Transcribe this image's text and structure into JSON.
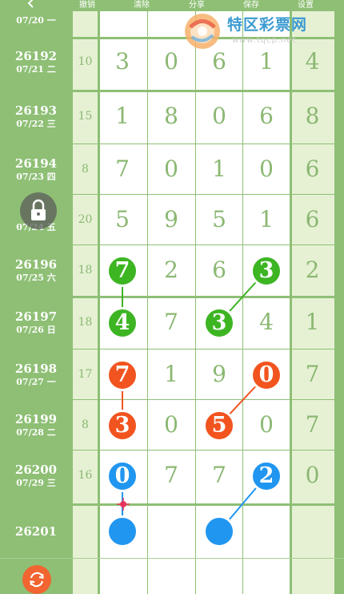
{
  "toolbar": {
    "back": "‹",
    "undo": "撤销",
    "clear": "清除",
    "share": "分享",
    "save": "保存",
    "settings": "设置"
  },
  "logo": {
    "text": "特区彩票网",
    "url": "www.tqcp.net"
  },
  "rows": [
    {
      "issue": "",
      "date": "07/20 一",
      "sum": "",
      "digits": [
        "",
        "",
        "",
        ""
      ],
      "extra": ""
    },
    {
      "issue": "26192",
      "date": "07/21 二",
      "sum": "10",
      "digits": [
        "3",
        "0",
        "6",
        "1"
      ],
      "extra": "4"
    },
    {
      "issue": "26193",
      "date": "07/22 三",
      "sum": "15",
      "digits": [
        "1",
        "8",
        "0",
        "6"
      ],
      "extra": "8"
    },
    {
      "issue": "26194",
      "date": "07/23 四",
      "sum": "8",
      "digits": [
        "7",
        "0",
        "1",
        "0"
      ],
      "extra": "6"
    },
    {
      "issue": "",
      "date": "07/24 五",
      "sum": "20",
      "digits": [
        "5",
        "9",
        "5",
        "1"
      ],
      "extra": "6"
    },
    {
      "issue": "26196",
      "date": "07/25 六",
      "sum": "18",
      "digits": [
        "7",
        "2",
        "6",
        "3"
      ],
      "extra": "2"
    },
    {
      "issue": "26197",
      "date": "07/26 日",
      "sum": "18",
      "digits": [
        "4",
        "7",
        "3",
        "4"
      ],
      "extra": "1"
    },
    {
      "issue": "26198",
      "date": "07/27 一",
      "sum": "17",
      "digits": [
        "7",
        "1",
        "9",
        "0"
      ],
      "extra": "7"
    },
    {
      "issue": "26199",
      "date": "07/28 二",
      "sum": "8",
      "digits": [
        "3",
        "0",
        "5",
        "0"
      ],
      "extra": "7"
    },
    {
      "issue": "26200",
      "date": "07/29 三",
      "sum": "16",
      "digits": [
        "0",
        "7",
        "7",
        "2"
      ],
      "extra": "0"
    },
    {
      "issue": "26201",
      "date": "",
      "sum": "",
      "digits": [
        "",
        "",
        "",
        ""
      ],
      "extra": ""
    }
  ],
  "marks": [
    {
      "row": 5,
      "col": 0,
      "color": "green",
      "label": "7"
    },
    {
      "row": 5,
      "col": 3,
      "color": "green",
      "label": "3"
    },
    {
      "row": 6,
      "col": 0,
      "color": "green",
      "label": "4"
    },
    {
      "row": 6,
      "col": 2,
      "color": "green",
      "label": "3"
    },
    {
      "row": 7,
      "col": 0,
      "color": "red",
      "label": "7"
    },
    {
      "row": 7,
      "col": 3,
      "color": "red",
      "label": "0"
    },
    {
      "row": 8,
      "col": 0,
      "color": "red",
      "label": "3"
    },
    {
      "row": 8,
      "col": 2,
      "color": "red",
      "label": "5"
    },
    {
      "row": 9,
      "col": 0,
      "color": "blue",
      "label": "0"
    },
    {
      "row": 9,
      "col": 3,
      "color": "blue",
      "label": "2"
    },
    {
      "row": 10,
      "col": 0,
      "color": "blue",
      "label": ""
    },
    {
      "row": 10,
      "col": 2,
      "color": "blue",
      "label": ""
    }
  ],
  "links": [
    {
      "from": 0,
      "to": 2,
      "color": "#3db523"
    },
    {
      "from": 1,
      "to": 3,
      "color": "#3db523"
    },
    {
      "from": 4,
      "to": 6,
      "color": "#f2541f"
    },
    {
      "from": 5,
      "to": 7,
      "color": "#f2541f"
    },
    {
      "from": 8,
      "to": 10,
      "color": "#2196f0"
    },
    {
      "from": 9,
      "to": 11,
      "color": "#2196f0"
    }
  ],
  "colors": {
    "frame": "#8ebf75",
    "light_cell": "#e6f1d4",
    "digit": "#8bb872",
    "green": "#3db523",
    "red": "#f2541f",
    "blue": "#2196f0",
    "refresh": "#f26430"
  },
  "icons": {
    "back": "chevron-left-icon",
    "lock": "lock-icon",
    "refresh": "refresh-icon",
    "cursor": "crosshair-cursor-icon"
  }
}
